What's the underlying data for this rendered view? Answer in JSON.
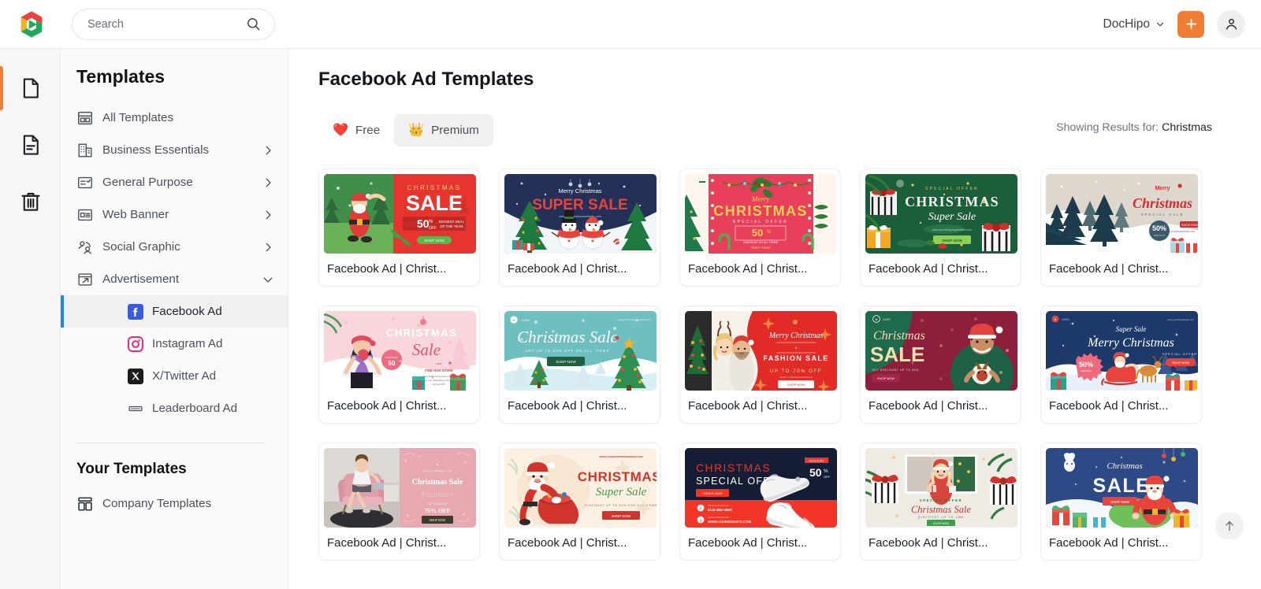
{
  "topbar": {
    "search": {
      "placeholder": "Search",
      "value": ""
    },
    "brand": {
      "label": "DocHipo"
    },
    "add_button_label": "+",
    "icons": {
      "search": "search-icon",
      "chevron": "chevron-down-icon",
      "plus": "plus-icon",
      "avatar": "user-avatar-icon"
    }
  },
  "rail": {
    "items": [
      {
        "name": "documents",
        "icon": "file-blank-icon",
        "active": true
      },
      {
        "name": "my-documents",
        "icon": "file-lines-icon",
        "active": false
      },
      {
        "name": "trash",
        "icon": "trash-icon",
        "active": false
      }
    ]
  },
  "sidebar": {
    "title": "Templates",
    "items": [
      {
        "label": "All Templates",
        "icon": "grid-layout-icon",
        "expandable": false
      },
      {
        "label": "Business Essentials",
        "icon": "building-icon",
        "expandable": true,
        "expanded": false
      },
      {
        "label": "General Purpose",
        "icon": "checklist-icon",
        "expandable": true,
        "expanded": false
      },
      {
        "label": "Web Banner",
        "icon": "banner-icon",
        "expandable": true,
        "expanded": false
      },
      {
        "label": "Social Graphic",
        "icon": "people-icon",
        "expandable": true,
        "expanded": false
      },
      {
        "label": "Advertisement",
        "icon": "ad-arrow-icon",
        "expandable": true,
        "expanded": true
      }
    ],
    "sub_items": [
      {
        "label": "Facebook Ad",
        "icon": "facebook-icon",
        "active": true
      },
      {
        "label": "Instagram Ad",
        "icon": "instagram-icon",
        "active": false
      },
      {
        "label": "X/Twitter Ad",
        "icon": "x-twitter-icon",
        "active": false
      },
      {
        "label": "Leaderboard Ad",
        "icon": "leaderboard-icon",
        "active": false
      }
    ],
    "your_templates_title": "Your Templates",
    "your_templates_items": [
      {
        "label": "Company Templates",
        "icon": "company-templates-icon"
      }
    ]
  },
  "main": {
    "page_title": "Facebook Ad Templates",
    "tabs": [
      {
        "label": "Free",
        "icon": "heart-icon",
        "glyph": "❤️",
        "active": false
      },
      {
        "label": "Premium",
        "icon": "crown-icon",
        "glyph": "👑",
        "active": true
      }
    ],
    "showing_results_label": "Showing Results for:",
    "showing_results_term": "Christmas",
    "scroll_top_icon": "arrow-up-icon",
    "templates": [
      {
        "title": "Facebook Ad | Christ...",
        "thumb": "santa-sale-red-green"
      },
      {
        "title": "Facebook Ad | Christ...",
        "thumb": "snowmen-navy-super-sale"
      },
      {
        "title": "Facebook Ad | Christ...",
        "thumb": "merry-christmas-pink-50"
      },
      {
        "title": "Facebook Ad | Christ...",
        "thumb": "green-super-sale-gifts"
      },
      {
        "title": "Facebook Ad | Christ...",
        "thumb": "snow-pines-beige-merry"
      },
      {
        "title": "Facebook Ad | Christ...",
        "thumb": "pink-shopper-christmas-sale"
      },
      {
        "title": "Facebook Ad | Christ...",
        "thumb": "teal-christmas-sale-trees"
      },
      {
        "title": "Facebook Ad | Christ...",
        "thumb": "couple-fashion-sale-red"
      },
      {
        "title": "Facebook Ad | Christ...",
        "thumb": "sweater-man-christmas-sale"
      },
      {
        "title": "Facebook Ad | Christ...",
        "thumb": "santa-sleigh-navy-super-sale"
      },
      {
        "title": "Facebook Ad | Christ...",
        "thumb": "furniture-pink-75-off"
      },
      {
        "title": "Facebook Ad | Christ...",
        "thumb": "santa-sack-cream-super-sale"
      },
      {
        "title": "Facebook Ad | Christ...",
        "thumb": "sneakers-navy-special-offer"
      },
      {
        "title": "Facebook Ad | Christ...",
        "thumb": "woman-gift-photo-frame"
      },
      {
        "title": "Facebook Ad | Christ...",
        "thumb": "blue-christmas-sale-santa"
      }
    ]
  }
}
